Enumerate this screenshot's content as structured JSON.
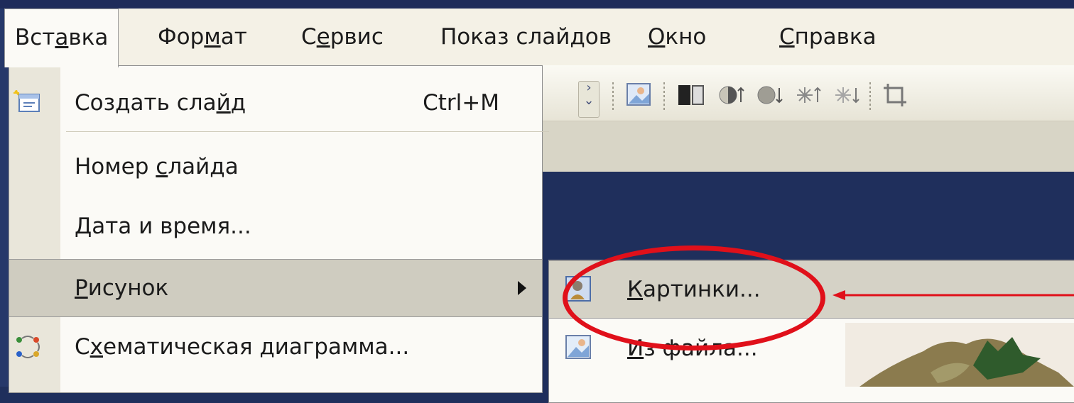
{
  "menubar": {
    "items": [
      {
        "pre": "Вст",
        "key": "а",
        "post": "вка"
      },
      {
        "pre": "Фор",
        "key": "м",
        "post": "ат"
      },
      {
        "pre": "С",
        "key": "е",
        "post": "рвис"
      },
      {
        "pre": "Показ слай",
        "key": "д",
        "post": "ов"
      },
      {
        "pre": "",
        "key": "О",
        "post": "кно"
      },
      {
        "pre": "",
        "key": "С",
        "post": "правка"
      }
    ]
  },
  "insert_menu": {
    "items": [
      {
        "pre": "Создать сла",
        "key": "й",
        "post": "д",
        "shortcut": "Ctrl+M",
        "icon": "new-slide-icon"
      },
      {
        "pre": "Номер ",
        "key": "с",
        "post": "лайда",
        "icon": ""
      },
      {
        "pre": "",
        "key": "Д",
        "post": "ата и время...",
        "icon": ""
      },
      {
        "pre": "",
        "key": "Р",
        "post": "исунок",
        "icon": "",
        "submenu": true
      },
      {
        "pre": "С",
        "key": "х",
        "post": "ематическая диаграмма...",
        "icon": "diagram-icon"
      }
    ]
  },
  "picture_submenu": {
    "items": [
      {
        "pre": "",
        "key": "К",
        "post": "артинки...",
        "icon": "clipart-icon"
      },
      {
        "pre": "",
        "key": "И",
        "post": "з файла...",
        "icon": "from-file-icon"
      }
    ]
  },
  "colors": {
    "background": "#1f2f5c",
    "menu_bg": "#fbfaf6",
    "highlight": "#cfccc0",
    "annotation_red": "#e0101a"
  }
}
